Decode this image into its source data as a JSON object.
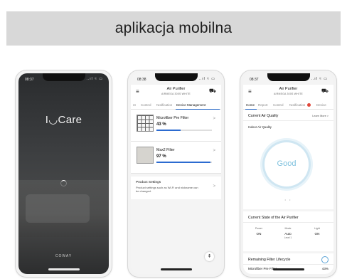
{
  "banner": {
    "title": "aplikacja mobilna"
  },
  "phone1": {
    "time": "08:37",
    "status_icons": "..ıl ≈ ▭",
    "logo": "I◡Care",
    "brand": "COWAY"
  },
  "phone2": {
    "time": "08:38",
    "status_icons": "..ıl ≈ ▭",
    "title": "Air Purifier",
    "subtitle": "AIRMEGA 300S WHITE",
    "tabs": [
      "nt",
      "Control",
      "Notification",
      "Device Management"
    ],
    "filters": [
      {
        "name": "Microfiber Pre Filter",
        "percent": "43 %",
        "level": 0.43
      },
      {
        "name": "Max2 Filter",
        "percent": "97 %",
        "level": 0.97
      }
    ],
    "settings": {
      "title": "Product Settings",
      "description": "Product settings such as Wi-Fi and nickname can be changed."
    },
    "fab_icon": "fab-icon"
  },
  "phone3": {
    "time": "08:37",
    "status_icons": "..ıl ≈ ▭",
    "title": "Air Purifier",
    "subtitle": "AIRMEGA 300S WHITE",
    "tabs": [
      "Home",
      "Report",
      "Control",
      "Notification",
      "Device"
    ],
    "air_quality": {
      "title": "Current Air Quality",
      "learn_more": "Learn More >",
      "indoor_label": "Indoor Air Quality",
      "status": "Good",
      "ring_color": "#7ec1de"
    },
    "state": {
      "title": "Current State of the Air Purifier",
      "items": [
        {
          "label": "Power",
          "value": "ON",
          "sub": ""
        },
        {
          "label": "Mode",
          "value": "Auto",
          "sub": "Level 1"
        },
        {
          "label": "Light",
          "value": "ON",
          "sub": ""
        }
      ]
    },
    "lifecycle": {
      "title": "Remaining Filter Lifecycle",
      "first_item": "Microfiber Pre Filter",
      "first_percent": "43%"
    }
  },
  "colors": {
    "accent": "#2c6bd0",
    "badge": "#e0473a"
  }
}
